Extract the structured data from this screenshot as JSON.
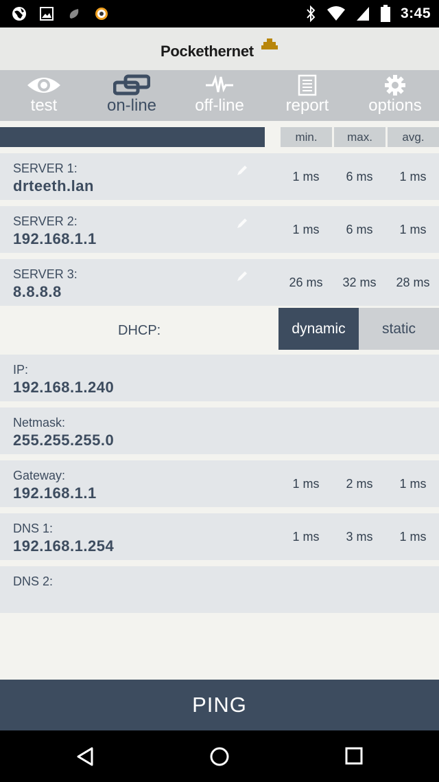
{
  "status_bar": {
    "time": "3:45",
    "left_icons": [
      "globe-icon",
      "image-icon",
      "leaf-icon",
      "gear-icon"
    ],
    "right_icons": [
      "bluetooth-icon",
      "wifi-icon",
      "signal-icon",
      "battery-icon"
    ]
  },
  "header": {
    "logo_text": "Pockethernet"
  },
  "nav": {
    "items": [
      {
        "label": "test",
        "icon": "eye-icon"
      },
      {
        "label": "on-line",
        "icon": "link-icon"
      },
      {
        "label": "off-line",
        "icon": "pulse-icon"
      },
      {
        "label": "report",
        "icon": "document-icon"
      },
      {
        "label": "options",
        "icon": "gear-icon"
      }
    ],
    "active": "on-line"
  },
  "columns": {
    "min": "min.",
    "max": "max.",
    "avg": "avg."
  },
  "servers": [
    {
      "label": "SERVER 1:",
      "value": "drteeth.lan",
      "min": "1 ms",
      "max": "6 ms",
      "avg": "1 ms"
    },
    {
      "label": "SERVER 2:",
      "value": "192.168.1.1",
      "min": "1 ms",
      "max": "6 ms",
      "avg": "1 ms"
    },
    {
      "label": "SERVER 3:",
      "value": "8.8.8.8",
      "min": "26 ms",
      "max": "32 ms",
      "avg": "28 ms"
    }
  ],
  "dhcp": {
    "label": "DHCP:",
    "dynamic": "dynamic",
    "static": "static",
    "selected": "dynamic"
  },
  "network": [
    {
      "label": "IP:",
      "value": "192.168.1.240",
      "min": "",
      "max": "",
      "avg": ""
    },
    {
      "label": "Netmask:",
      "value": "255.255.255.0",
      "min": "",
      "max": "",
      "avg": ""
    },
    {
      "label": "Gateway:",
      "value": "192.168.1.1",
      "min": "1 ms",
      "max": "2 ms",
      "avg": "1 ms"
    },
    {
      "label": "DNS 1:",
      "value": "192.168.1.254",
      "min": "1 ms",
      "max": "3 ms",
      "avg": "1 ms"
    },
    {
      "label": "DNS 2:",
      "value": "",
      "min": "",
      "max": "",
      "avg": ""
    }
  ],
  "actions": {
    "ping": "PING"
  },
  "colors": {
    "primary": "#3d4c5f",
    "row_bg": "#e3e6e9",
    "nav_bg": "#c3c6c9",
    "page_bg": "#f3f3ef",
    "logo_accent": "#b8860b"
  }
}
